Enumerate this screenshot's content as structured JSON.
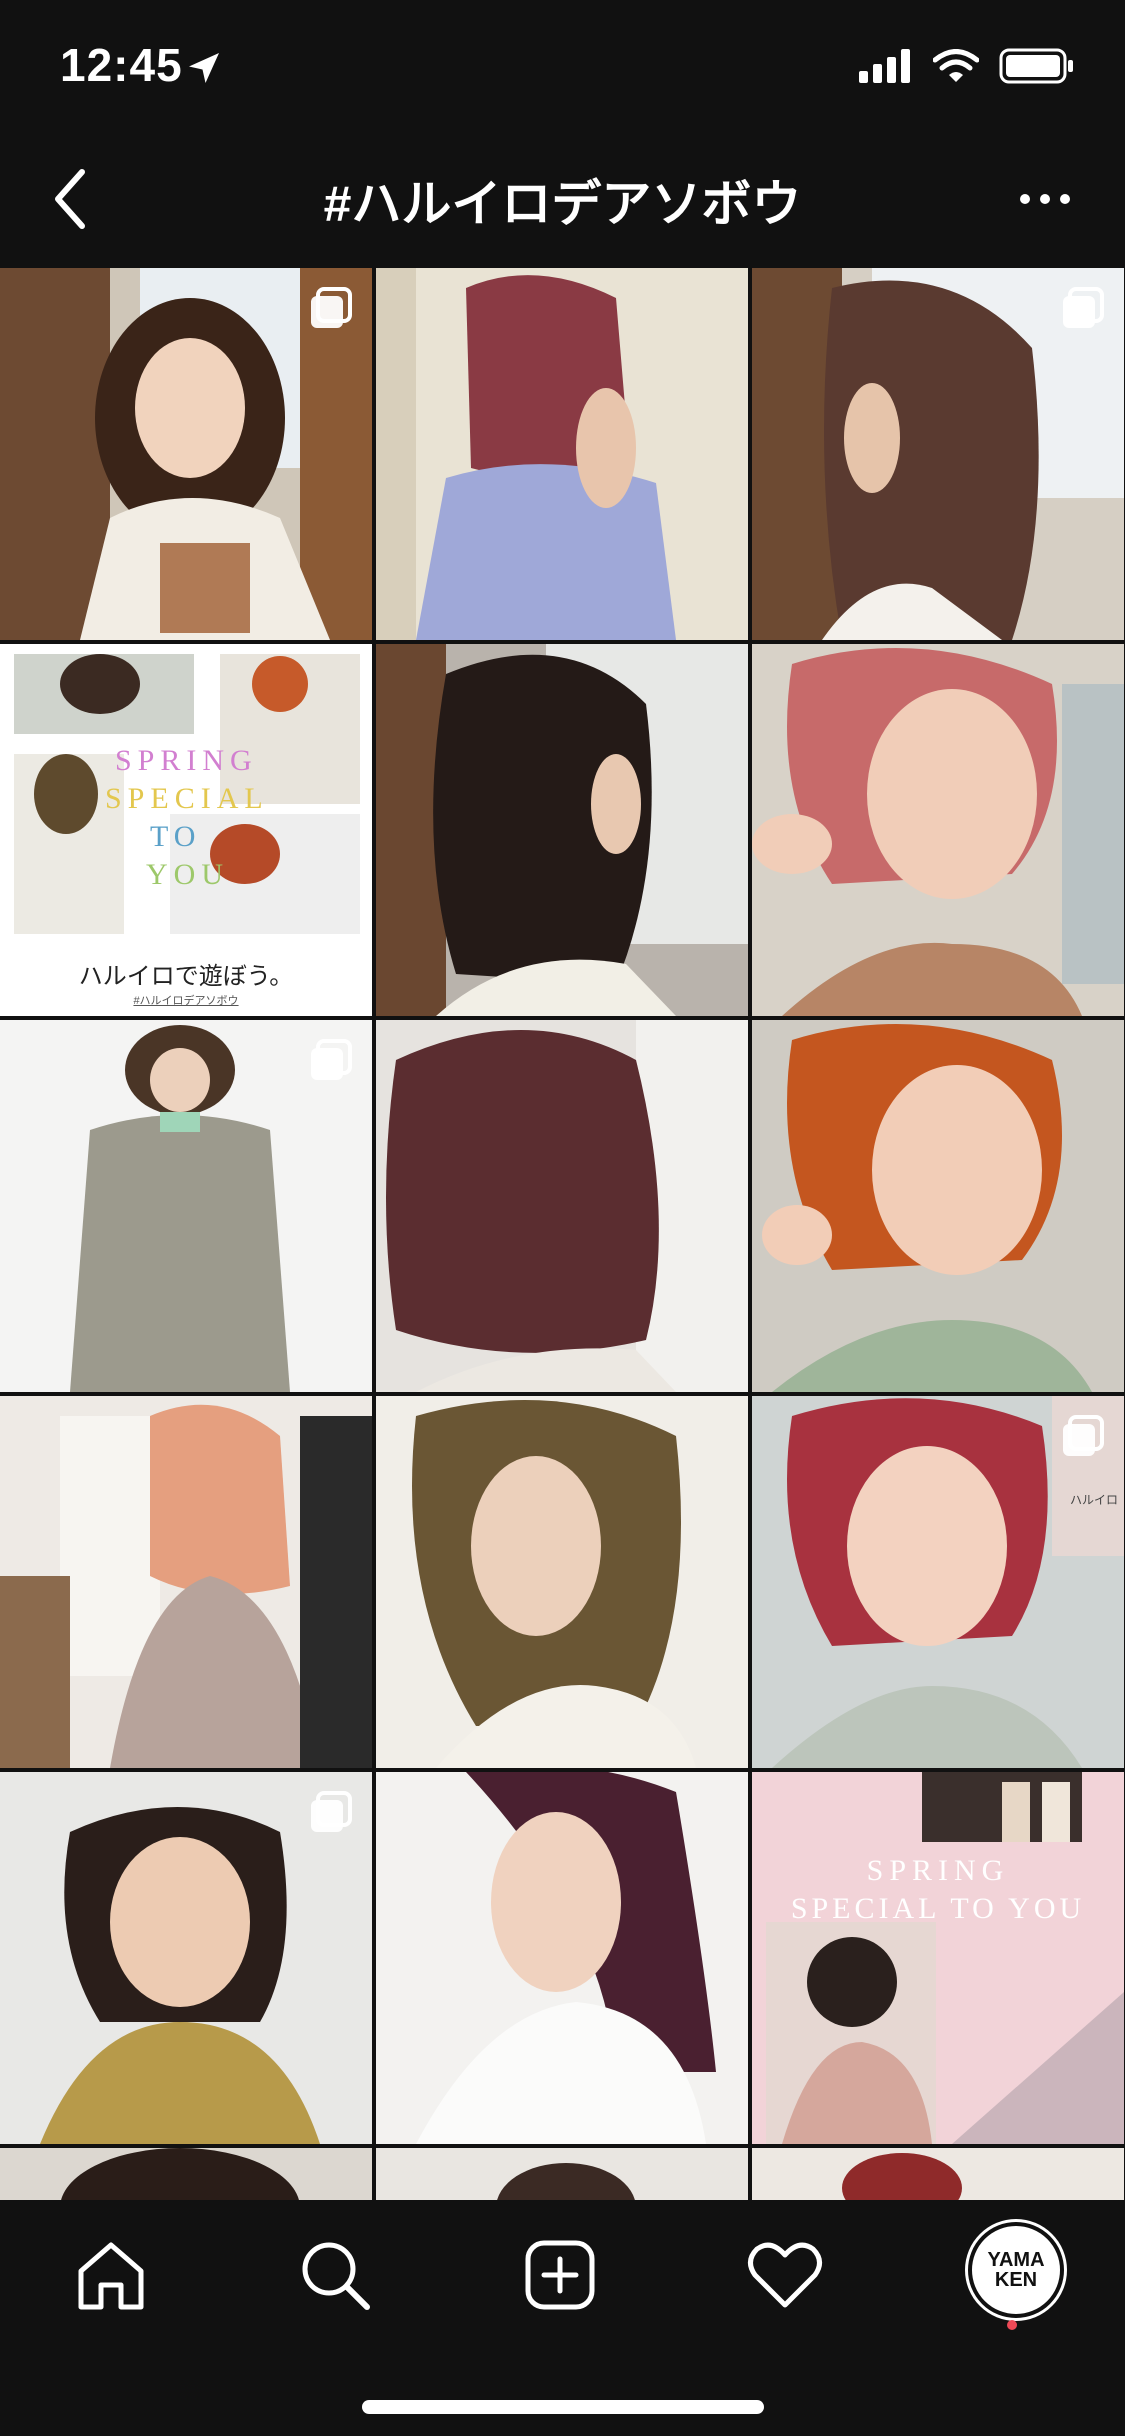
{
  "status": {
    "time": "12:45"
  },
  "header": {
    "title": "#ハルイロデアソボウ"
  },
  "posts": {
    "p4": {
      "line1": "SPRING",
      "line2": "SPECIAL",
      "line3": "TO",
      "line4": "YOU",
      "caption": "ハルイロで遊ぼう。",
      "tag": "#ハルイロデアソボウ"
    },
    "p15": {
      "line1": "SPRING",
      "line2": "SPECIAL TO YOU"
    },
    "p12": {
      "sign": "ハルイロ"
    }
  },
  "tabbar": {
    "items": [
      "home-icon",
      "search-icon",
      "new-post-icon",
      "activity-heart-icon",
      "profile-avatar"
    ],
    "avatar_text": "YAMA KEN"
  },
  "colors": {
    "background": "#111111",
    "notification": "#ed4956"
  }
}
